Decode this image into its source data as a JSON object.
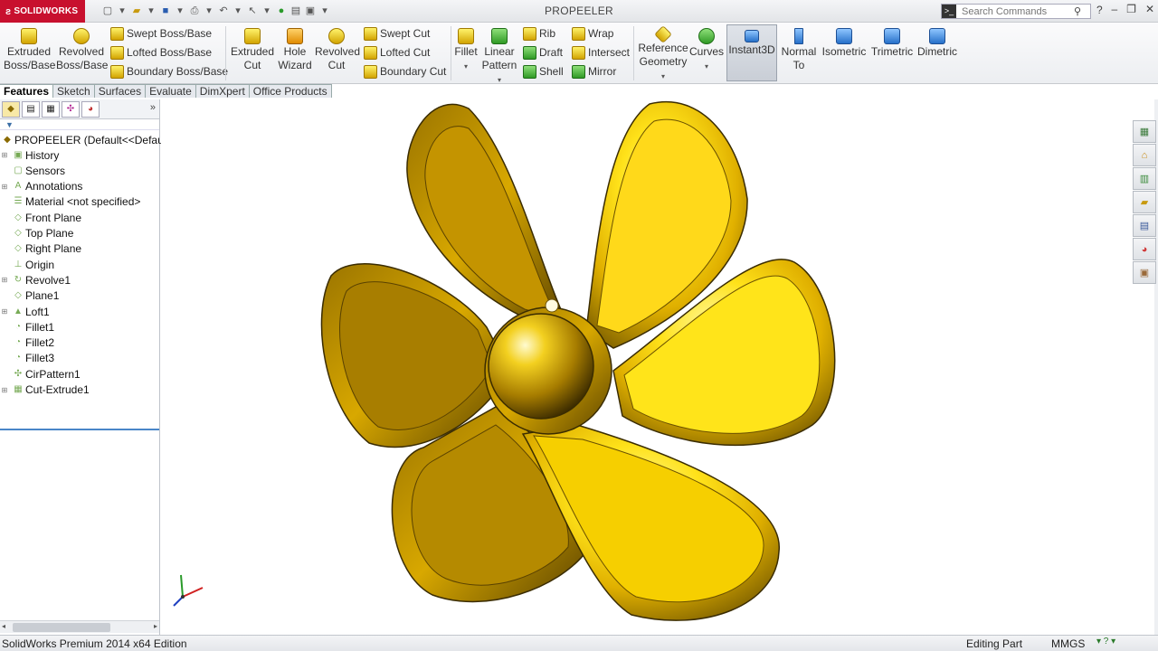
{
  "app": {
    "logo_text": "SOLIDWORKS",
    "title": "PROPEELER"
  },
  "search": {
    "placeholder": "Search Commands"
  },
  "ribbon": {
    "extruded_boss": "Extruded Boss/Base",
    "revolved_boss": "Revolved Boss/Base",
    "swept_boss": "Swept Boss/Base",
    "lofted_boss": "Lofted Boss/Base",
    "boundary_boss": "Boundary Boss/Base",
    "extruded_cut": "Extruded Cut",
    "hole_wizard": "Hole Wizard",
    "revolved_cut": "Revolved Cut",
    "swept_cut": "Swept Cut",
    "lofted_cut": "Lofted Cut",
    "boundary_cut": "Boundary Cut",
    "fillet": "Fillet",
    "linear_pattern": "Linear Pattern",
    "rib": "Rib",
    "draft": "Draft",
    "shell": "Shell",
    "wrap": "Wrap",
    "intersect": "Intersect",
    "mirror": "Mirror",
    "reference_geometry": "Reference Geometry",
    "curves": "Curves",
    "instant3d": "Instant3D",
    "normal_to": "Normal To",
    "isometric": "Isometric",
    "trimetric": "Trimetric",
    "dimetric": "Dimetric"
  },
  "tabs": [
    "Features",
    "Sketch",
    "Surfaces",
    "Evaluate",
    "DimXpert",
    "Office Products"
  ],
  "tree": {
    "root": "PROPEELER  (Default<<Default>",
    "items": [
      {
        "label": "History",
        "icon": "history-icon",
        "expandable": true
      },
      {
        "label": "Sensors",
        "icon": "sensors-icon",
        "expandable": false
      },
      {
        "label": "Annotations",
        "icon": "annotations-icon",
        "expandable": true
      },
      {
        "label": "Material <not specified>",
        "icon": "material-icon",
        "expandable": false
      },
      {
        "label": "Front Plane",
        "icon": "plane-icon",
        "expandable": false
      },
      {
        "label": "Top Plane",
        "icon": "plane-icon",
        "expandable": false
      },
      {
        "label": "Right Plane",
        "icon": "plane-icon",
        "expandable": false
      },
      {
        "label": "Origin",
        "icon": "origin-icon",
        "expandable": false
      },
      {
        "label": "Revolve1",
        "icon": "revolve-icon",
        "expandable": true
      },
      {
        "label": "Plane1",
        "icon": "plane-icon",
        "expandable": false
      },
      {
        "label": "Loft1",
        "icon": "loft-icon",
        "expandable": true
      },
      {
        "label": "Fillet1",
        "icon": "fillet-icon",
        "expandable": false
      },
      {
        "label": "Fillet2",
        "icon": "fillet-icon",
        "expandable": false
      },
      {
        "label": "Fillet3",
        "icon": "fillet-icon",
        "expandable": false
      },
      {
        "label": "CirPattern1",
        "icon": "circular-pattern-icon",
        "expandable": false
      },
      {
        "label": "Cut-Extrude1",
        "icon": "cut-extrude-icon",
        "expandable": true
      }
    ]
  },
  "status": {
    "edition": "SolidWorks Premium 2014 x64 Edition",
    "mode": "Editing Part",
    "units": "MMGS"
  },
  "colors": {
    "brand": "#c8102e",
    "gold_light": "#fff36b",
    "gold_dark": "#8a6a00",
    "active_tab_underline": "#4a86c8"
  }
}
